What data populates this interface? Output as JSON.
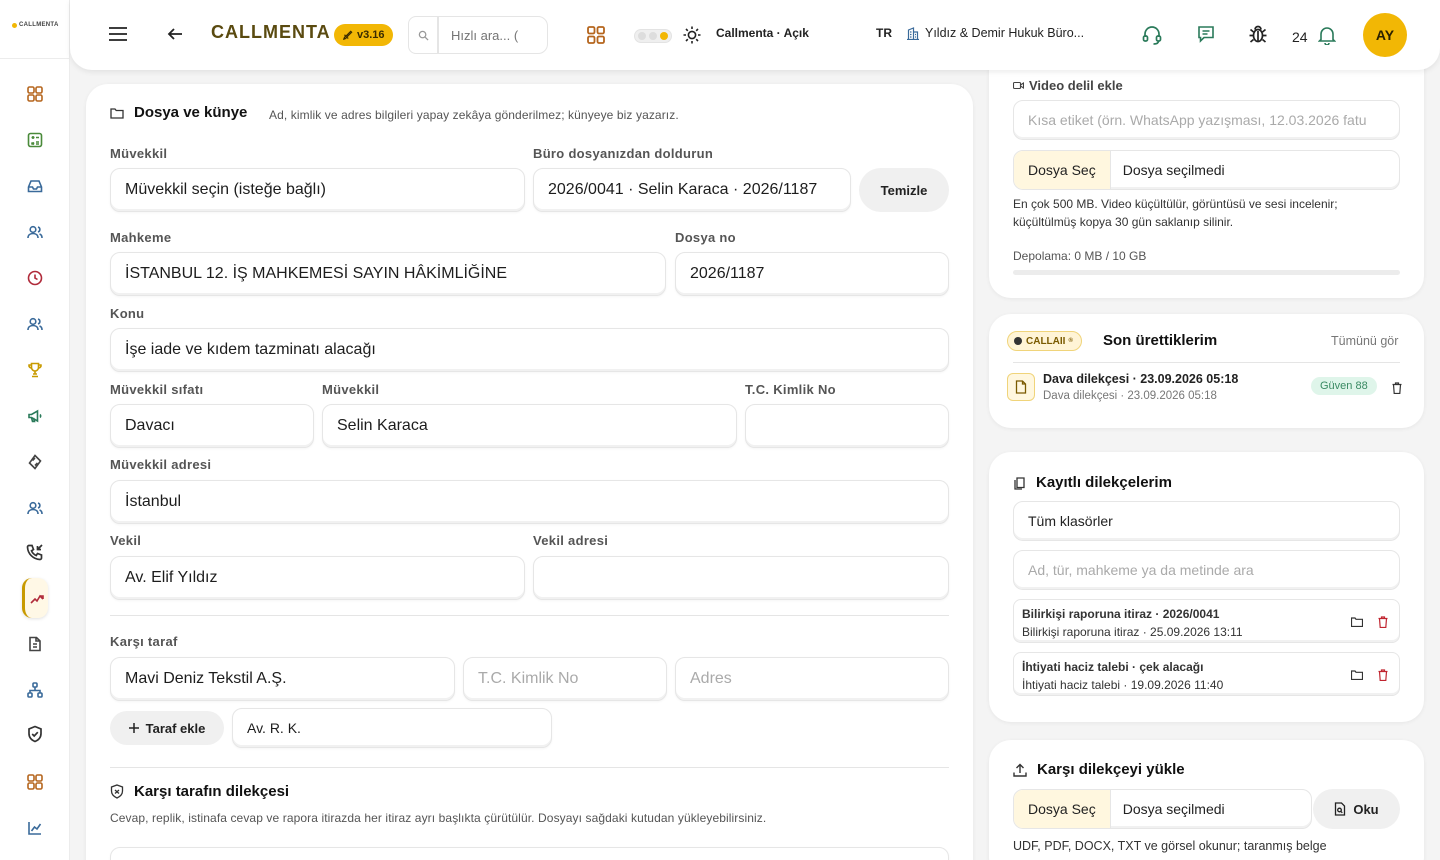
{
  "rail": {
    "logo": "CALLMENTA",
    "items": [
      "dashboard-icon",
      "calculator-icon",
      "inbox-icon",
      "users-icon",
      "clock-icon",
      "contacts-icon",
      "trophy-icon",
      "megaphone-icon",
      "puzzle-icon",
      "team-icon",
      "call-log-icon",
      "gavel-icon",
      "document-icon",
      "sitemap-icon",
      "shield-icon",
      "grid-icon",
      "chart-icon"
    ]
  },
  "header": {
    "brand": "CALLMENTA",
    "version": "v3.16",
    "search_placeholder": "Hızlı ara... (",
    "status": "Callmenta · Açık",
    "lang": "TR",
    "office": "Yıldız & Demir Hukuk Büro...",
    "notif_count": "24",
    "avatar": "AY"
  },
  "main": {
    "title": "Dosya ve künye",
    "note": "Ad, kimlik ve adres bilgileri yapay zekâya gönderilmez; künyeye biz yazarız.",
    "muvekkil_label": "Müvekkil",
    "muvekkil_value": "Müvekkil seçin (isteğe bağlı)",
    "buro_label": "Büro dosyanızdan doldurun",
    "buro_value": "2026/0041 · Selin Karaca · 2026/1187",
    "clear_button": "Temizle",
    "mahkeme_label": "Mahkeme",
    "mahkeme_value": "İSTANBUL 12. İŞ MAHKEMESİ SAYIN HÂKİMLİĞİNE",
    "dosya_no_label": "Dosya no",
    "dosya_no_value": "2026/1187",
    "konu_label": "Konu",
    "konu_value": "İşe iade ve kıdem tazminatı alacağı",
    "sifat_label": "Müvekkil sıfatı",
    "sifat_value": "Davacı",
    "muvekkil2_label": "Müvekkil",
    "muvekkil2_value": "Selin Karaca",
    "tc_label": "T.C. Kimlik No",
    "tc_value": "",
    "adres_label": "Müvekkil adresi",
    "adres_value": "İstanbul",
    "vekil_label": "Vekil",
    "vekil_value": "Av. Elif Yıldız",
    "vekil_adres_label": "Vekil adresi",
    "vekil_adres_value": "",
    "karsi_label": "Karşı taraf",
    "karsi_value": "Mavi Deniz Tekstil A.Ş.",
    "karsi_tc_placeholder": "T.C. Kimlik No",
    "karsi_adres_placeholder": "Adres",
    "add_party_button": "Taraf ekle",
    "karsi_vekil_value": "Av. R. K.",
    "petition_title": "Karşı tarafın dilekçesi",
    "petition_note": "Cevap, replik, istinafa cevap ve rapora itirazda her itiraz ayrı başlıkta çürütülür. Dosyayı sağdaki kutudan yükleyebilirsiniz."
  },
  "video": {
    "title": "Video delil ekle",
    "label_placeholder": "Kısa etiket (örn. WhatsApp yazışması, 12.03.2026 fatu",
    "file_button": "Dosya Seç",
    "file_none": "Dosya seçilmedi",
    "note": "En çok 500 MB. Video küçültülür, görüntüsü ve sesi incelenir; küçültülmüş kopya 30 gün saklanıp silinir.",
    "storage": "Depolama: 0 MB / 10 GB",
    "storage_fraction": 0
  },
  "recent": {
    "badge": "CALLAII",
    "badge_mark": "®",
    "title": "Son ürettiklerim",
    "see_all": "Tümünü gör",
    "item_title": "Dava dilekçesi · 23.09.2026 05:18",
    "item_sub": "Dava dilekçesi · 23.09.2026 05:18",
    "item_badge": "Güven 88"
  },
  "saved": {
    "title": "Kayıtlı dilekçelerim",
    "folder_value": "Tüm klasörler",
    "search_placeholder": "Ad, tür, mahkeme ya da metinde ara",
    "items": [
      {
        "title": "Bilirkişi raporuna itiraz · 2026/0041",
        "sub": "Bilirkişi raporuna itiraz · 25.09.2026 13:11"
      },
      {
        "title": "İhtiyati haciz talebi · çek alacağı",
        "sub": "İhtiyati haciz talebi · 19.09.2026 11:40"
      }
    ]
  },
  "upload": {
    "title": "Karşı dilekçeyi yükle",
    "file_button": "Dosya Seç",
    "file_none": "Dosya seçilmedi",
    "read_button": "Oku",
    "note": "UDF, PDF, DOCX, TXT ve görsel okunur; taranmış belge"
  },
  "colors": {
    "accent": "#f2b705",
    "brand_text": "#5a4a10",
    "rail_icon": "#b5651d"
  }
}
